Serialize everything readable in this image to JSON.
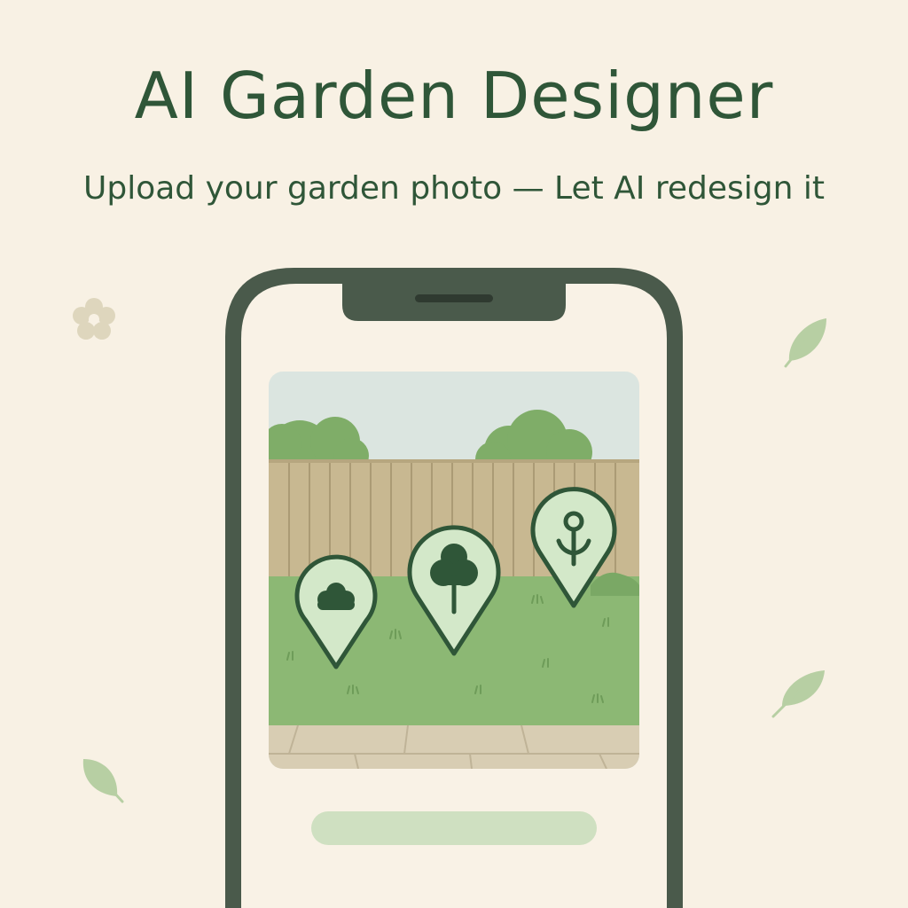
{
  "header": {
    "title": "AI Garden Designer",
    "subtitle": "Upload your garden photo — Let AI redesign it"
  },
  "phone": {
    "photo_preview": {
      "markers": [
        {
          "name": "shrub-marker",
          "icon": "bush-icon"
        },
        {
          "name": "tree-marker",
          "icon": "tree-icon"
        },
        {
          "name": "flower-marker",
          "icon": "flower-icon"
        }
      ]
    },
    "action_bar": {
      "state": "loading-placeholder"
    }
  },
  "decorations": {
    "icons": [
      "flower-icon",
      "leaf-icon",
      "leaf-icon",
      "leaf-icon"
    ]
  },
  "colors": {
    "background": "#f8f1e4",
    "primary": "#2f5638",
    "phone_frame": "#4a5a4b",
    "grass": "#8cb874",
    "fence": "#c8b891",
    "sky": "#dbe5e0",
    "marker_fill": "#d3e8c9",
    "bar": "#cfe0c1"
  }
}
